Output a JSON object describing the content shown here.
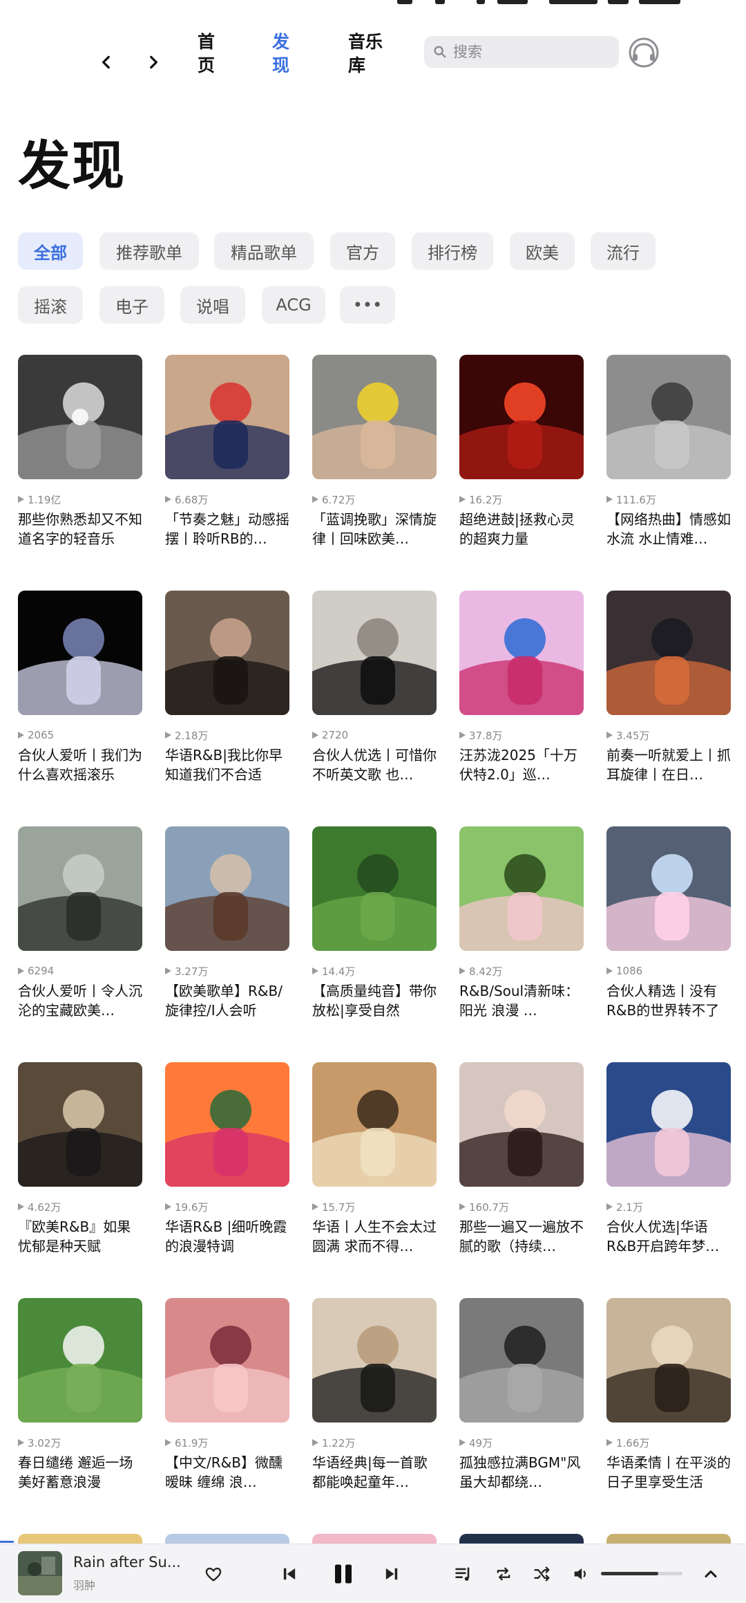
{
  "nav": {
    "tabs": [
      {
        "label": "首页",
        "active": false
      },
      {
        "label": "发现",
        "active": true
      },
      {
        "label": "音乐库",
        "active": false
      }
    ],
    "search_placeholder": "搜索"
  },
  "page_title": "发现",
  "filters": [
    {
      "label": "全部",
      "active": true
    },
    {
      "label": "推荐歌单",
      "active": false
    },
    {
      "label": "精品歌单",
      "active": false
    },
    {
      "label": "官方",
      "active": false
    },
    {
      "label": "排行榜",
      "active": false
    },
    {
      "label": "欧美",
      "active": false
    },
    {
      "label": "流行",
      "active": false
    },
    {
      "label": "摇滚",
      "active": false
    },
    {
      "label": "电子",
      "active": false
    },
    {
      "label": "说唱",
      "active": false
    },
    {
      "label": "ACG",
      "active": false
    },
    {
      "label": "•••",
      "active": false
    }
  ],
  "playlists": [
    {
      "plays": "1.19亿",
      "title": "那些你熟悉却又不知道名字的轻音乐"
    },
    {
      "plays": "6.68万",
      "title": "「节奏之魅」动感摇摆丨聆听RB的…"
    },
    {
      "plays": "6.72万",
      "title": "「蓝调挽歌」深情旋律丨回味欧美…"
    },
    {
      "plays": "16.2万",
      "title": "超绝进鼓|拯救心灵的超爽力量"
    },
    {
      "plays": "111.6万",
      "title": "【网络热曲】情感如水流 水止情难…"
    },
    {
      "plays": "2065",
      "title": "合伙人爱听丨我们为什么喜欢摇滚乐"
    },
    {
      "plays": "2.18万",
      "title": "华语R&B|我比你早知道我们不合适"
    },
    {
      "plays": "2720",
      "title": "合伙人优选丨可惜你不听英文歌 也…"
    },
    {
      "plays": "37.8万",
      "title": "汪苏泷2025「十万伏特2.0」巡…"
    },
    {
      "plays": "3.45万",
      "title": "前奏一听就爱上丨抓耳旋律丨在日…"
    },
    {
      "plays": "6294",
      "title": "合伙人爱听丨令人沉沦的宝藏欧美…"
    },
    {
      "plays": "3.27万",
      "title": "【欧美歌单】R&B/旋律控/I人会听"
    },
    {
      "plays": "14.4万",
      "title": "【高质量纯音】带你放松|享受自然"
    },
    {
      "plays": "8.42万",
      "title": "R&B/Soul清新味：阳光 浪漫 …"
    },
    {
      "plays": "1086",
      "title": "合伙人精选丨没有R&B的世界转不了"
    },
    {
      "plays": "4.62万",
      "title": "『欧美R&B』如果忧郁是种天赋"
    },
    {
      "plays": "19.6万",
      "title": "华语R&B |细听晚霞的浪漫特调"
    },
    {
      "plays": "15.7万",
      "title": "华语丨人生不会太过圆满 求而不得…"
    },
    {
      "plays": "160.7万",
      "title": "那些一遍又一遍放不腻的歌（持续…"
    },
    {
      "plays": "2.1万",
      "title": "合伙人优选|华语R&B开启跨年梦…"
    },
    {
      "plays": "3.02万",
      "title": "春日缱绻 邂逅一场美好蓄意浪漫"
    },
    {
      "plays": "61.9万",
      "title": "【中文/R&B】微醺 暧昧 缠绵 浪…"
    },
    {
      "plays": "1.22万",
      "title": "华语经典|每一首歌都能唤起童年…"
    },
    {
      "plays": "49万",
      "title": "孤独感拉满BGM\"风虽大却都绕…"
    },
    {
      "plays": "1.66万",
      "title": "华语柔情丨在平淡的日子里享受生活"
    }
  ],
  "player": {
    "track": "Rain after Su...",
    "artist": "羽肿",
    "volume": 0.7
  },
  "colors": {
    "accent": "#3b6fe0",
    "chip_bg": "#f0f0f2",
    "chip_active_bg": "#e6ecfb"
  }
}
